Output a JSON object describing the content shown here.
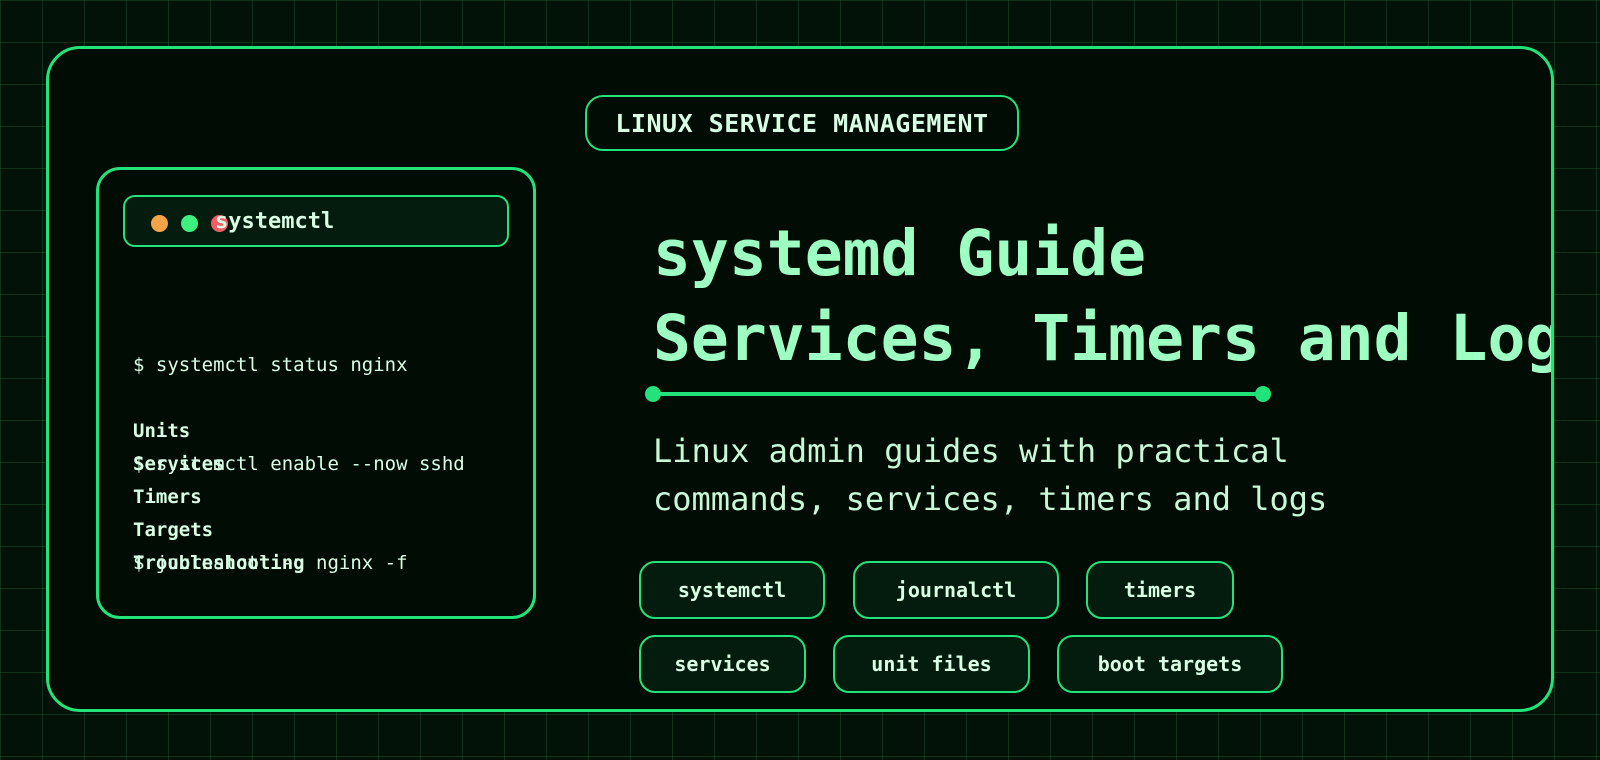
{
  "header": {
    "badge": "LINUX SERVICE MANAGEMENT"
  },
  "terminal": {
    "title": "systemctl",
    "window_controls": [
      "orange-dot",
      "green-dot",
      "red-dot"
    ],
    "commands": [
      "$ systemctl status nginx",
      "$ systemctl enable --now sshd",
      "$ journalctl -u nginx -f"
    ],
    "topics": [
      "Units",
      "Services",
      "Timers",
      "Targets",
      "Troubleshooting"
    ]
  },
  "hero": {
    "title_line1": "systemd Guide",
    "title_line2": "Services, Timers and Logs",
    "subtitle_line1": "Linux admin guides with practical",
    "subtitle_line2": "commands, services, timers and logs"
  },
  "tags": [
    "systemctl",
    "journalctl",
    "timers",
    "services",
    "unit files",
    "boot targets"
  ],
  "colors": {
    "background": "#021208",
    "accent": "#22e27a",
    "title": "#9dffc2",
    "text": "#d8ffe4"
  }
}
